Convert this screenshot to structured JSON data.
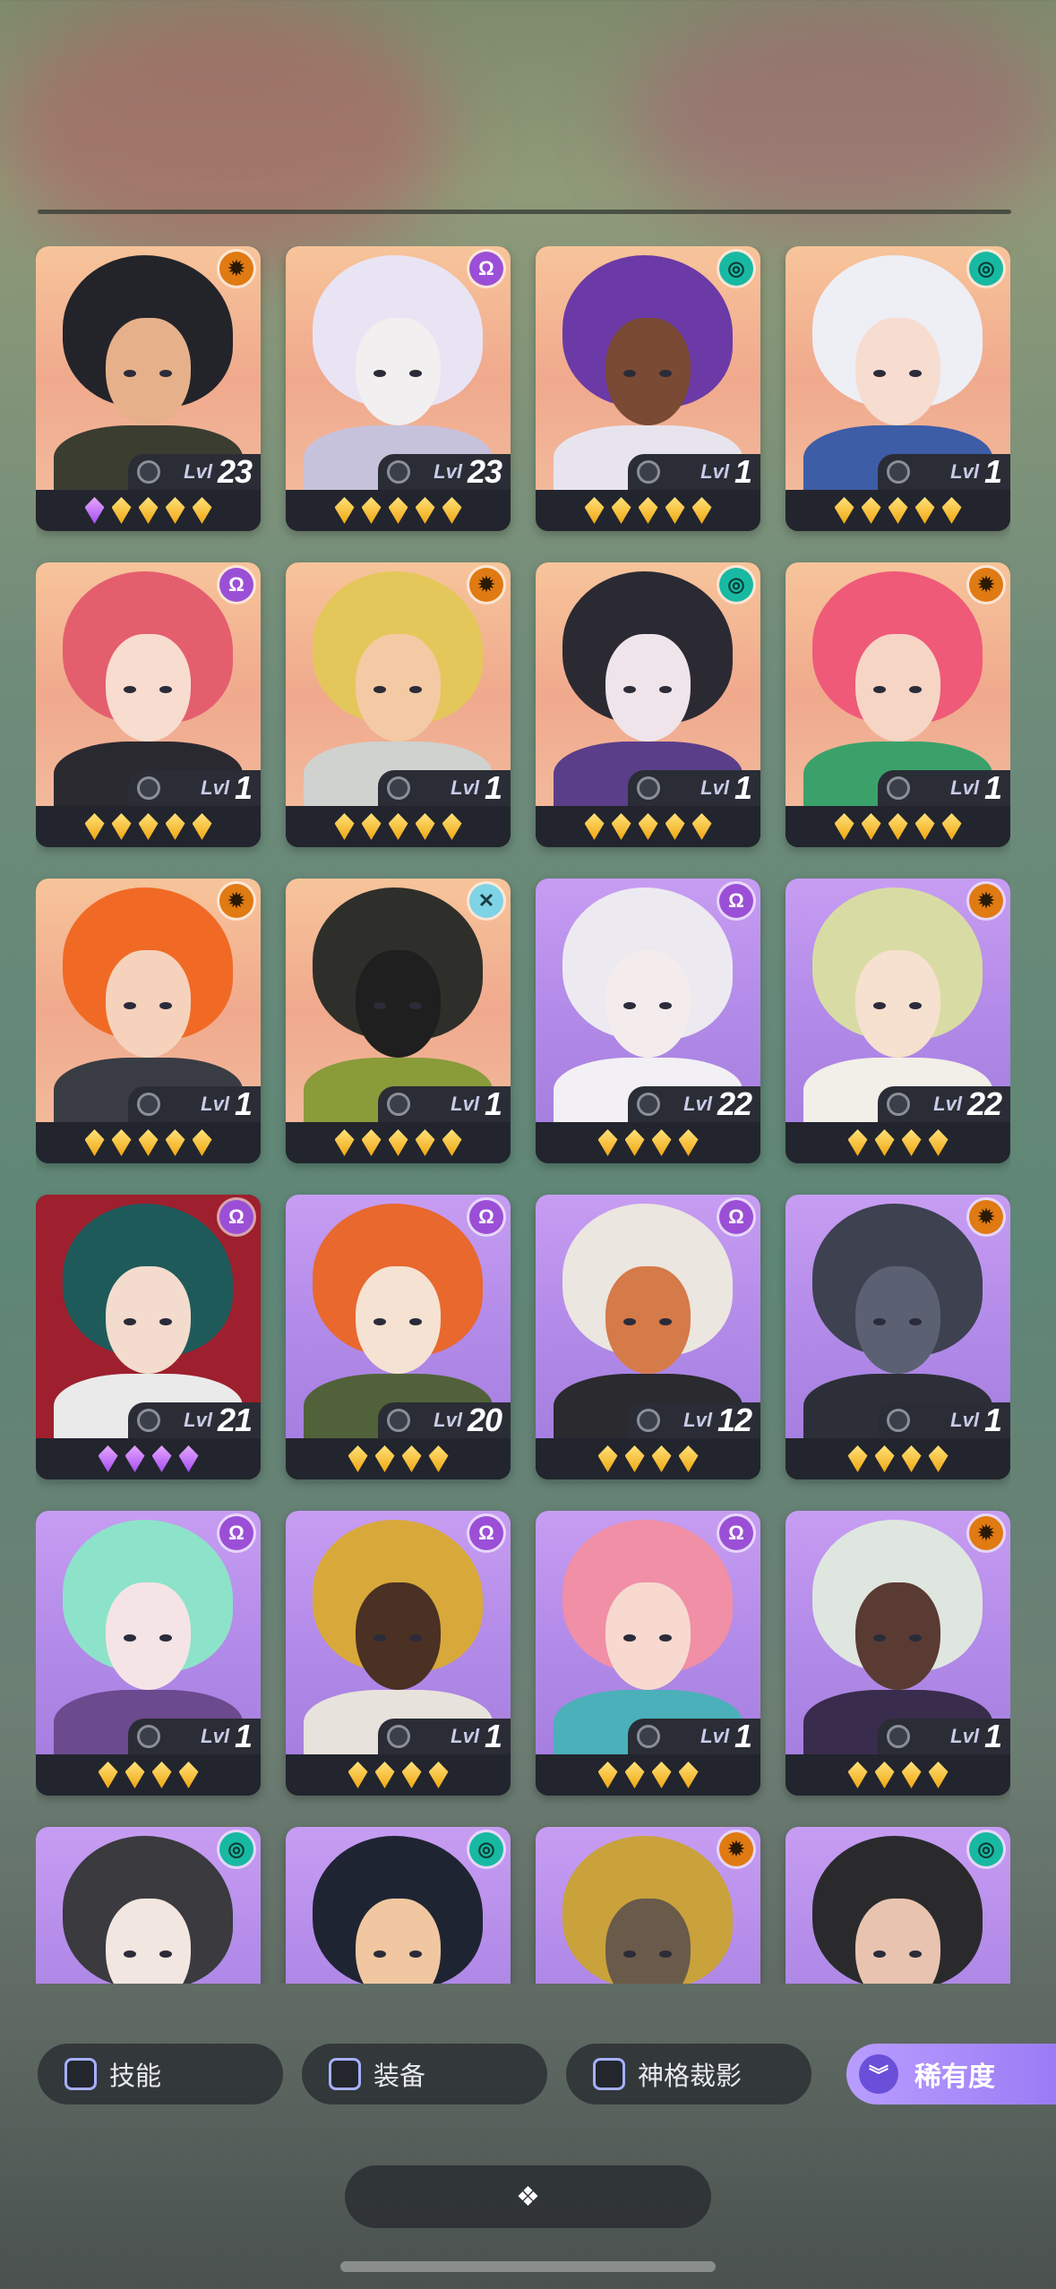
{
  "colors": {
    "accent": "#9b7bf5",
    "gem_gold": "#f0a611",
    "gem_purple": "#a64df0",
    "card_bg": "#22252d"
  },
  "level_prefix": "Lvl",
  "heroes": [
    {
      "element": "sun-icon",
      "level": "23",
      "stars": 5,
      "star_color": "gold",
      "first_purple": true,
      "bg": "warm",
      "hair": "#23242a",
      "face": "#e6b18a",
      "body": "#3a3d30"
    },
    {
      "element": "omega-icon",
      "level": "23",
      "stars": 5,
      "star_color": "gold",
      "bg": "warm",
      "hair": "#e9e4f4",
      "face": "#f1efef",
      "body": "#c7c2dc"
    },
    {
      "element": "swirl-icon",
      "level": "1",
      "stars": 5,
      "star_color": "gold",
      "bg": "warm",
      "hair": "#6b3aa6",
      "face": "#7a4a35",
      "body": "#e8e4ee"
    },
    {
      "element": "swirl-icon",
      "level": "1",
      "stars": 5,
      "star_color": "gold",
      "bg": "warm",
      "hair": "#eeeef5",
      "face": "#f7dcd0",
      "body": "#3e5da7"
    },
    {
      "element": "omega-icon",
      "level": "1",
      "stars": 5,
      "star_color": "gold",
      "bg": "warm",
      "hair": "#e45f6e",
      "face": "#f8dccf",
      "body": "#2b2930"
    },
    {
      "element": "sun-icon",
      "level": "1",
      "stars": 5,
      "star_color": "gold",
      "bg": "warm",
      "hair": "#e4c75a",
      "face": "#f3caa3",
      "body": "#cfd2cf"
    },
    {
      "element": "swirl-icon",
      "level": "1",
      "stars": 5,
      "star_color": "gold",
      "bg": "warm",
      "hair": "#2b2a33",
      "face": "#efe4ea",
      "body": "#5a3e8a"
    },
    {
      "element": "sun-icon",
      "level": "1",
      "stars": 5,
      "star_color": "gold",
      "bg": "warm",
      "hair": "#ef5a79",
      "face": "#f6d5c5",
      "body": "#3ba16b"
    },
    {
      "element": "sun-icon",
      "level": "1",
      "stars": 5,
      "star_color": "gold",
      "bg": "warm",
      "hair": "#f06a25",
      "face": "#f6d2bc",
      "body": "#3a3c44"
    },
    {
      "element": "cross-icon",
      "level": "1",
      "stars": 5,
      "star_color": "gold",
      "bg": "warm",
      "hair": "#2e2f2a",
      "face": "#1e1f1e",
      "body": "#8a9b3a"
    },
    {
      "element": "omega-icon",
      "level": "22",
      "stars": 4,
      "star_color": "gold",
      "bg": "purple",
      "hair": "#eceaf0",
      "face": "#f4ecec",
      "body": "#f2f0f4"
    },
    {
      "element": "sun-icon",
      "level": "22",
      "stars": 4,
      "star_color": "gold",
      "bg": "purple",
      "hair": "#d8dca4",
      "face": "#f6e0cf",
      "body": "#f2eee8"
    },
    {
      "element": "omega-icon",
      "level": "21",
      "stars": 4,
      "star_color": "purple",
      "bg": "purple",
      "hair": "#1f5a5a",
      "face": "#f3dccd",
      "body": "#eaeaea",
      "bgOverride": "#9e1f2d"
    },
    {
      "element": "omega-icon",
      "level": "20",
      "stars": 4,
      "star_color": "gold",
      "bg": "purple",
      "hair": "#e8682e",
      "face": "#f5e2d2",
      "body": "#51623a"
    },
    {
      "element": "omega-icon",
      "level": "12",
      "stars": 4,
      "star_color": "gold",
      "bg": "purple",
      "hair": "#ebe6df",
      "face": "#d57a49",
      "body": "#2a2a2f"
    },
    {
      "element": "sun-icon",
      "level": "1",
      "stars": 4,
      "star_color": "gold",
      "bg": "purple",
      "hair": "#3d4150",
      "face": "#5b6172",
      "body": "#2d2f38"
    },
    {
      "element": "omega-icon",
      "level": "1",
      "stars": 4,
      "star_color": "gold",
      "bg": "purple",
      "hair": "#8de3c9",
      "face": "#f5e4e6",
      "body": "#6b4a8e"
    },
    {
      "element": "omega-icon",
      "level": "1",
      "stars": 4,
      "star_color": "gold",
      "bg": "purple",
      "hair": "#d8a93a",
      "face": "#4b3024",
      "body": "#e8e2dc"
    },
    {
      "element": "omega-icon",
      "level": "1",
      "stars": 4,
      "star_color": "gold",
      "bg": "purple",
      "hair": "#f08fa6",
      "face": "#f7d9cf",
      "body": "#4bb0b9"
    },
    {
      "element": "sun-icon",
      "level": "1",
      "stars": 4,
      "star_color": "gold",
      "bg": "purple",
      "hair": "#dfe6df",
      "face": "#5a3b33",
      "body": "#3a2c4c"
    },
    {
      "element": "swirl-icon",
      "level": "",
      "stars": 0,
      "star_color": "gold",
      "bg": "purple",
      "hair": "#3a3a3f",
      "face": "#f2e6e0",
      "body": "#cfd2d6"
    },
    {
      "element": "swirl-icon",
      "level": "",
      "stars": 0,
      "star_color": "gold",
      "bg": "purple",
      "hair": "#1f2433",
      "face": "#f0c7a0",
      "body": "#2a2f46"
    },
    {
      "element": "sun-icon",
      "level": "",
      "stars": 0,
      "star_color": "gold",
      "bg": "purple",
      "hair": "#c9a23c",
      "face": "#6a5a4a",
      "body": "#3a3d44"
    },
    {
      "element": "swirl-icon",
      "level": "",
      "stars": 0,
      "star_color": "gold",
      "bg": "purple",
      "hair": "#2a2a2d",
      "face": "#e8c4b0",
      "body": "#3b3a40"
    }
  ],
  "filters": {
    "skill": "技能",
    "equipment": "装备",
    "divine": "神格裁影"
  },
  "sort": {
    "label": "稀有度"
  }
}
